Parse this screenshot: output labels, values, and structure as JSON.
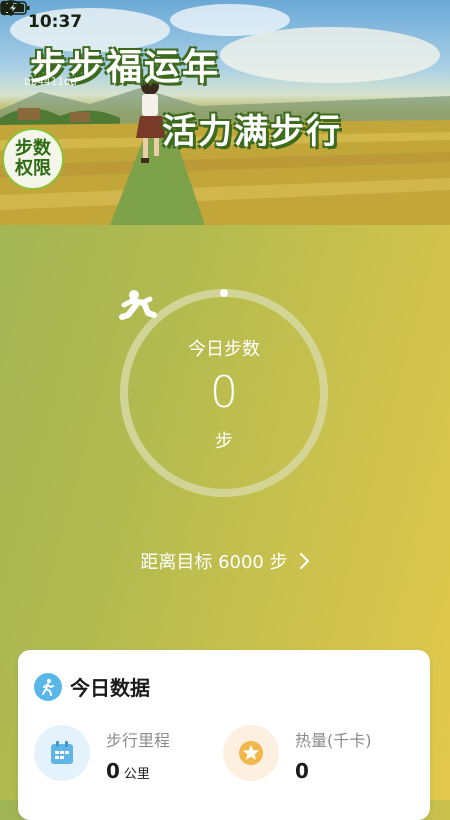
{
  "status_bar": {
    "time": "10:37",
    "icons": [
      "bluetooth-icon",
      "mute-bell-icon",
      "wifi-icon",
      "alert-icon",
      "battery-charging-icon"
    ]
  },
  "banner": {
    "title": "步步福运年",
    "subtitle": "活力满步行",
    "id_text": "bb4411dd",
    "badge_text": "步数\n权限"
  },
  "steps": {
    "label": "今日步数",
    "value": "0",
    "unit": "步",
    "progress": 0,
    "goal_text": "距离目标 6000 步"
  },
  "today_card": {
    "title": "今日数据",
    "stats": [
      {
        "label": "步行里程",
        "value": "0",
        "unit": "公里",
        "icon": "calendar-icon"
      },
      {
        "label": "热量(千卡)",
        "value": "0",
        "unit": "",
        "icon": "star-medal-icon"
      }
    ]
  },
  "colors": {
    "background_start": "#9fb456",
    "background_end": "#e2c84c",
    "ring": "#d6d8a2",
    "card": "#ffffff",
    "accent_blue": "#58b6e8",
    "accent_orange": "#f2b74a"
  }
}
